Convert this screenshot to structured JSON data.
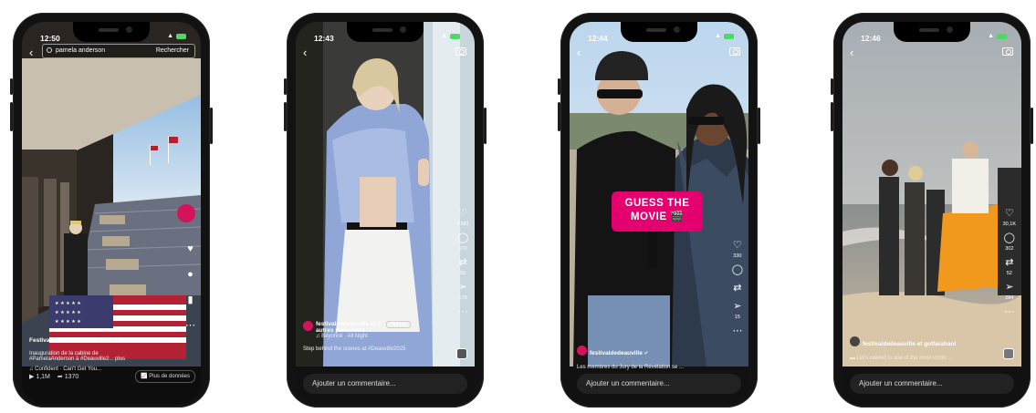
{
  "phones": [
    {
      "time": "12:50",
      "search": {
        "value": "pamela anderson",
        "action": "Rechercher"
      },
      "account": "Festival de Deauville",
      "year": "2023-9-6",
      "caption_1": "Inauguration de la cabine de",
      "caption_2": "#PamelaAnderson à #Deauville2... plus",
      "music": "Confident · Can't Get You...",
      "views": "1,1M",
      "shares": "1370",
      "more_data": "Plus de données"
    },
    {
      "time": "12:43",
      "likes": "4 581",
      "comments": "170",
      "reposts": "55",
      "sends": "170",
      "account_1": "festivaldedeauville et 3",
      "account_2": "autres personnes",
      "follow": "Suivre",
      "music": "Beyoncé · All Night",
      "caption": "Step behind the scenes at #Deauville2025",
      "comment_placeholder": "Ajouter un commentaire..."
    },
    {
      "time": "12:44",
      "overlay_line1": "GUESS THE",
      "overlay_line2": "MOVIE 🎬",
      "likes": "330",
      "comments": "—",
      "sends": "15",
      "account": "festivaldedeauville",
      "caption": "Les membres du Jury de la Révélation se ...",
      "comment_placeholder": "Ajouter un commentaire..."
    },
    {
      "time": "12:46",
      "likes": "30,1K",
      "comments": "302",
      "reposts": "52",
      "sends": "284",
      "account": "festivaldedeauville et golfarahani",
      "caption": "Let's rewind to one of the most iconic ...",
      "comment_placeholder": "Ajouter un commentaire..."
    }
  ],
  "colors": {
    "accent": "#e4006f",
    "dark": "#111111"
  }
}
